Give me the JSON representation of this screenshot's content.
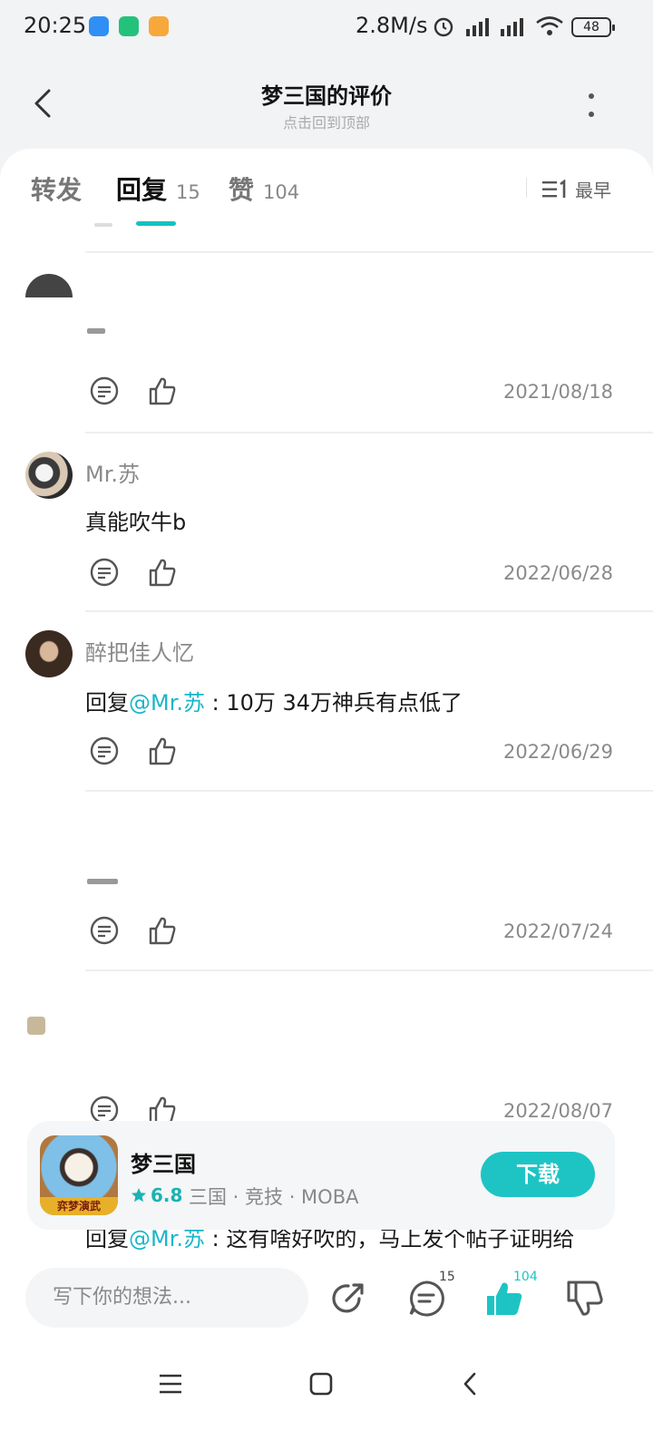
{
  "status_bar": {
    "time": "20:25",
    "speed": "2.8M/s",
    "battery": "48"
  },
  "header": {
    "title": "梦三国的评价",
    "subtitle": "点击回到顶部"
  },
  "tabs": {
    "forward": "转发",
    "reply": "回复",
    "reply_count": "15",
    "like": "赞",
    "like_count": "104",
    "sort_label": "最早"
  },
  "comments": [
    {
      "username": "",
      "content": "",
      "date": "2021/08/18"
    },
    {
      "username": "Mr.苏",
      "content": "真能吹牛b",
      "date": "2022/06/28"
    },
    {
      "username": "醉把佳人忆",
      "reply_prefix": "回复",
      "mention": "@Mr.苏",
      "content": " : 10万 34万神兵有点低了",
      "date": "2022/06/29"
    },
    {
      "username": "",
      "content": "",
      "date": "2022/07/24"
    },
    {
      "username": "",
      "content": "",
      "date": "2022/08/07"
    }
  ],
  "app_card": {
    "name": "梦三国",
    "rating": "6.8",
    "tags": "三国 · 竞技 · MOBA",
    "download": "下载",
    "icon_caption": "弈梦演武"
  },
  "peek": {
    "prefix": "回复",
    "mention": "@Mr.苏",
    "content": " : 这有啥好吹的，马上发个帖子证明给"
  },
  "bottom": {
    "input_placeholder": "写下你的想法...",
    "comment_count": "15",
    "like_count": "104"
  },
  "colors": {
    "accent": "#1ec4c4",
    "mention": "#1ab5c8"
  }
}
